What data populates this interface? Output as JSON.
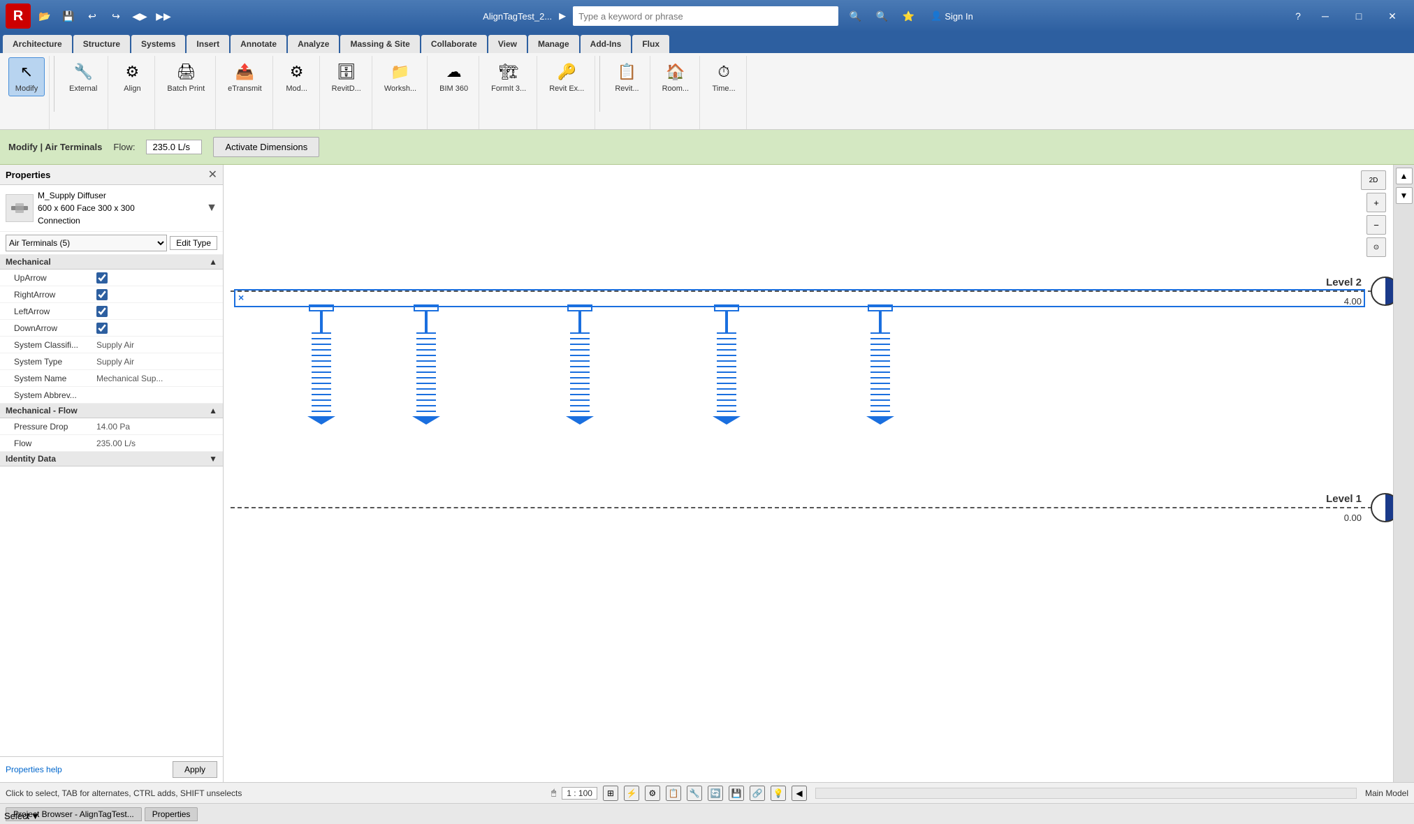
{
  "titlebar": {
    "app_initial": "R",
    "file_name": "AlignTagTest_2...",
    "search_placeholder": "Type a keyword or phrase",
    "sign_in": "Sign In",
    "help_icon": "?"
  },
  "qat": {
    "buttons": [
      "⬛",
      "💾",
      "↩",
      "↩",
      "◀▶",
      "▶▶"
    ]
  },
  "ribbon": {
    "tabs": [
      {
        "label": "Architecture",
        "active": false
      },
      {
        "label": "Structure",
        "active": false
      },
      {
        "label": "Systems",
        "active": false
      },
      {
        "label": "Insert",
        "active": false
      },
      {
        "label": "Annotate",
        "active": false
      },
      {
        "label": "Analyze",
        "active": false
      },
      {
        "label": "Massing & Site",
        "active": false
      },
      {
        "label": "Collaborate",
        "active": false
      },
      {
        "label": "View",
        "active": false
      },
      {
        "label": "Manage",
        "active": false
      },
      {
        "label": "Add-Ins",
        "active": false
      },
      {
        "label": "Flux",
        "active": false
      }
    ],
    "groups": [
      {
        "buttons": [
          {
            "label": "Modify",
            "icon": "↖",
            "active": true
          }
        ]
      },
      {
        "buttons": [
          {
            "label": "External",
            "icon": "🔧"
          },
          {
            "label": "Align",
            "icon": "⚙"
          },
          {
            "label": "Batch Print",
            "icon": "🖨"
          },
          {
            "label": "eTransmit",
            "icon": "📤"
          },
          {
            "label": "Mod...",
            "icon": "⚙"
          },
          {
            "label": "RevitD...",
            "icon": "🗄"
          },
          {
            "label": "Worksh...",
            "icon": "📁"
          },
          {
            "label": "BIM 360",
            "icon": "☁"
          },
          {
            "label": "FormIt 3...",
            "icon": "🏗"
          },
          {
            "label": "Revit Ex...",
            "icon": "🔑"
          }
        ]
      },
      {
        "buttons": [
          {
            "label": "Revit...",
            "icon": "📋"
          },
          {
            "label": "Room...",
            "icon": "🏠"
          },
          {
            "label": "Time...",
            "icon": "⏱"
          }
        ]
      }
    ]
  },
  "contextual": {
    "title": "Modify | Air Terminals",
    "flow_label": "Flow:",
    "flow_value": "235.0 L/s",
    "activate_dimensions": "Activate Dimensions"
  },
  "properties": {
    "title": "Properties",
    "close_icon": "✕",
    "type_name": "M_Supply Diffuser",
    "type_detail": "600 x 600 Face 300 x 300",
    "type_detail2": "Connection",
    "dropdown_icon": "▼",
    "instance_label": "Air Terminals (5)",
    "edit_type_label": "Edit Type",
    "sections": [
      {
        "label": "Mechanical",
        "collapse_icon": "▲",
        "rows": [
          {
            "label": "UpArrow",
            "type": "checkbox",
            "checked": true
          },
          {
            "label": "RightArrow",
            "type": "checkbox",
            "checked": true
          },
          {
            "label": "LeftArrow",
            "type": "checkbox",
            "checked": true
          },
          {
            "label": "DownArrow",
            "type": "checkbox",
            "checked": true
          },
          {
            "label": "System Classifi...",
            "type": "text",
            "value": "Supply Air"
          },
          {
            "label": "System Type",
            "type": "text",
            "value": "Supply Air"
          },
          {
            "label": "System Name",
            "type": "text",
            "value": "Mechanical Sup..."
          },
          {
            "label": "System Abbrev...",
            "type": "text",
            "value": ""
          }
        ]
      },
      {
        "label": "Mechanical - Flow",
        "collapse_icon": "▲",
        "rows": [
          {
            "label": "Pressure Drop",
            "type": "text",
            "value": "14.00 Pa"
          },
          {
            "label": "Flow",
            "type": "text",
            "value": "235.00 L/s"
          }
        ]
      },
      {
        "label": "Identity Data",
        "collapse_icon": "▼",
        "rows": []
      }
    ],
    "help_link": "Properties help",
    "apply_btn": "Apply"
  },
  "canvas": {
    "level2": {
      "label": "Level 2",
      "elevation": "4.00"
    },
    "level1": {
      "label": "Level 1",
      "elevation": "0.00"
    }
  },
  "statusbar": {
    "message": "Click to select, TAB for alternates, CTRL adds, SHIFT unselects",
    "scale": "1 : 100",
    "main_model": "Main Model"
  },
  "bottom_tabs": [
    {
      "label": "Project Browser - AlignTagTest..."
    },
    {
      "label": "Properties"
    }
  ],
  "select_label": "Select"
}
